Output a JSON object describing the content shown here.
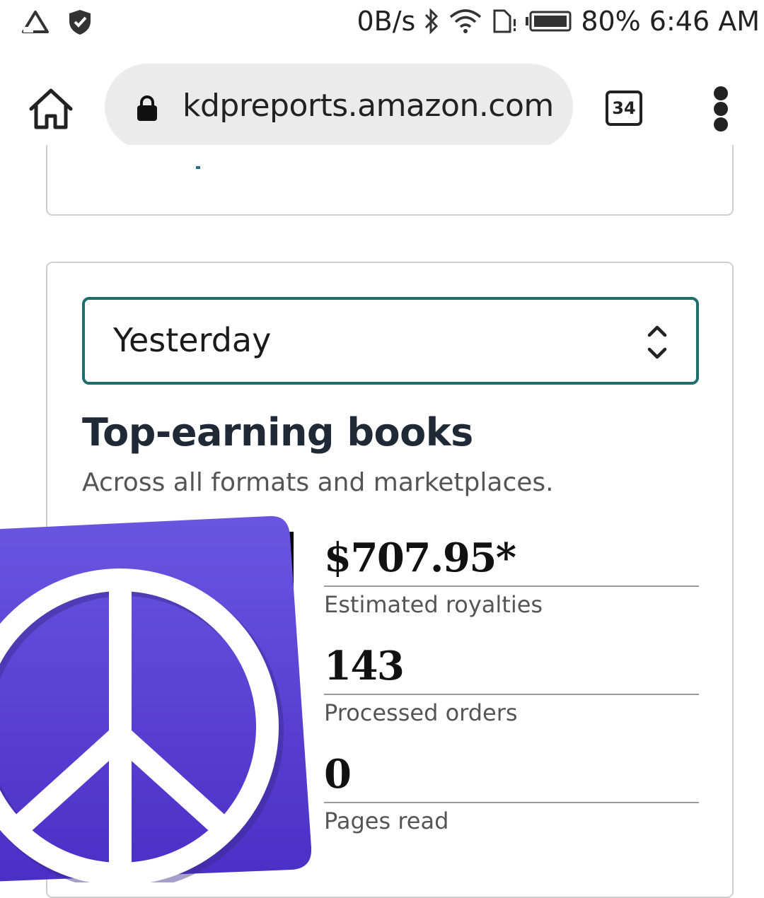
{
  "status_bar": {
    "network_speed": "0B/s",
    "battery_percent": "80%",
    "time": "6:46 AM",
    "icons": [
      "warning-triangle-icon",
      "shield-icon",
      "bluetooth-icon",
      "wifi-icon",
      "sim-card-icon",
      "battery-icon"
    ]
  },
  "browser": {
    "url": "kdpreports.amazon.com",
    "tab_count": "34"
  },
  "report": {
    "date_range": "Yesterday",
    "heading": "Top-earning books",
    "subheading": "Across all formats and marketplaces.",
    "metrics": [
      {
        "value": "$707.95*",
        "label": "Estimated royalties"
      },
      {
        "value": "143",
        "label": "Processed orders"
      },
      {
        "value": "0",
        "label": "Pages read"
      }
    ]
  },
  "overlay": {
    "icon": "peace-sign-icon",
    "color_top": "#6a55e0",
    "color_bottom": "#4a2fc6"
  }
}
